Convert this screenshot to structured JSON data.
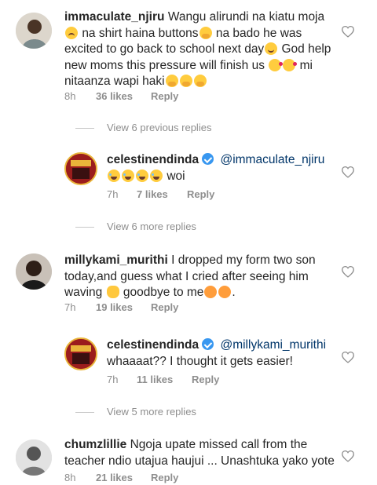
{
  "comments": [
    {
      "username": "immaculate_njiru",
      "text_lines": [
        "Wangu alirundi na kiatu  moja",
        "na shirt haina buttons",
        "excited to go back to school next day",
        "new moms this pressure will finish us",
        "nitaanza wapi haki"
      ],
      "text_segments": {
        "l1b": "na shirt haina buttons",
        "l1c": " na bado he was",
        "l2a": "excited to go back to school next day",
        "l2b": " God help",
        "l3a": "new moms this pressure will finish us ",
        "l3b": " mi",
        "l4a": "nitaanza wapi haki"
      },
      "time": "8h",
      "likes": "36 likes",
      "reply": "Reply"
    },
    {
      "username": "millykami_murithi",
      "text_first": "I dropped my form two son",
      "text_line2": "today,and guess what I cried after seeing him",
      "text_line3a": "waving",
      "text_line3b": " goodbye to me",
      "text_line3c": ".",
      "time": "7h",
      "likes": "19 likes",
      "reply": "Reply"
    },
    {
      "username": "chumzlillie",
      "text_first": "Ngoja upate missed call from the",
      "text_line2": "teacher ndio utajua haujui ... Unashtuka yako yote",
      "time": "8h",
      "likes": "21 likes",
      "reply": "Reply"
    }
  ],
  "replies": [
    {
      "username": "celestinendinda",
      "mention": "@immaculate_njiru",
      "text": "woi",
      "time": "7h",
      "likes": "7 likes",
      "reply": "Reply"
    },
    {
      "username": "celestinendinda",
      "mention": "@millykami_murithi",
      "text": "whaaaat?? I thought it gets easier!",
      "time": "7h",
      "likes": "11 likes",
      "reply": "Reply"
    }
  ],
  "view_replies": [
    "View 6 previous replies",
    "View 6 more replies",
    "View 5 more replies"
  ],
  "colors": {
    "text": "#262626",
    "meta": "#8e8e8e",
    "mention": "#003569",
    "verified": "#3897f0"
  },
  "icons": {
    "like": "heart-outline-icon",
    "verified": "verified-badge-icon"
  }
}
